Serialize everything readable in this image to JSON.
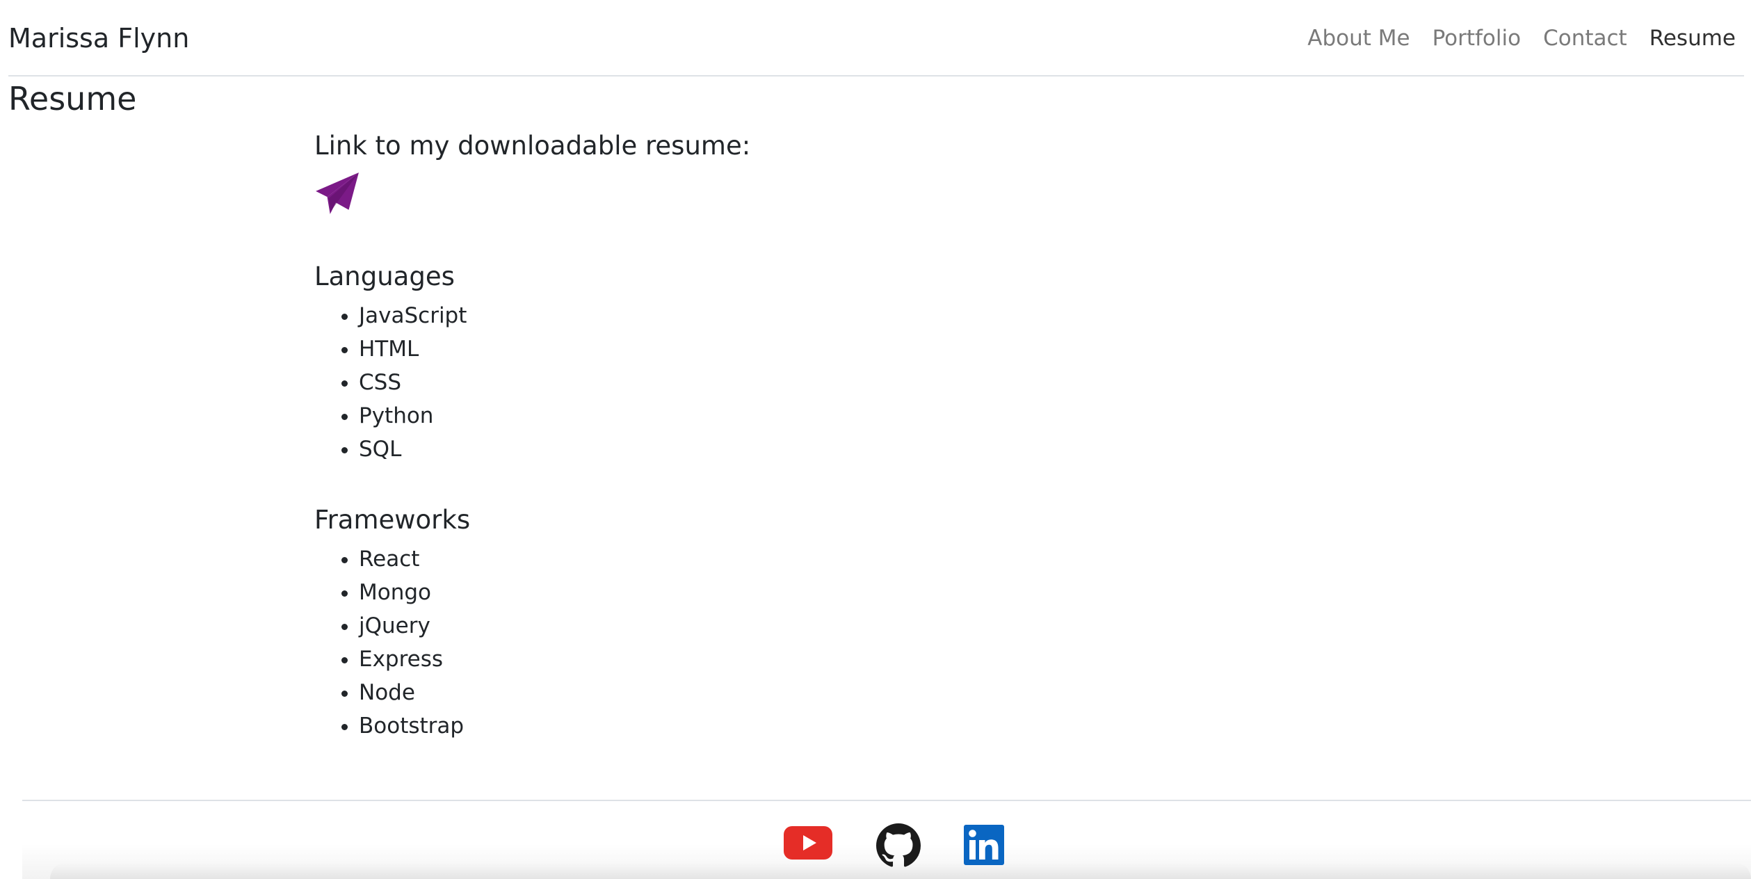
{
  "navbar": {
    "brand": "Marissa Flynn",
    "links": [
      {
        "label": "About Me"
      },
      {
        "label": "Portfolio"
      },
      {
        "label": "Contact"
      },
      {
        "label": "Resume",
        "active": true
      }
    ]
  },
  "page_title": "Resume",
  "resume": {
    "link_heading": "Link to my downloadable resume:",
    "link_icon": "paper-plane-icon",
    "icon_color": "#7b1a87"
  },
  "sections": [
    {
      "title": "Languages",
      "items": [
        "JavaScript",
        "HTML",
        "CSS",
        "Python",
        "SQL"
      ]
    },
    {
      "title": "Frameworks",
      "items": [
        "React",
        "Mongo",
        "jQuery",
        "Express",
        "Node",
        "Bootstrap"
      ]
    }
  ],
  "footer": {
    "social": [
      {
        "icon": "youtube-icon",
        "color": "#e52d27"
      },
      {
        "icon": "github-icon",
        "color": "#1b1b1b"
      },
      {
        "icon": "linkedin-icon",
        "color": "#0a66c2"
      }
    ]
  }
}
